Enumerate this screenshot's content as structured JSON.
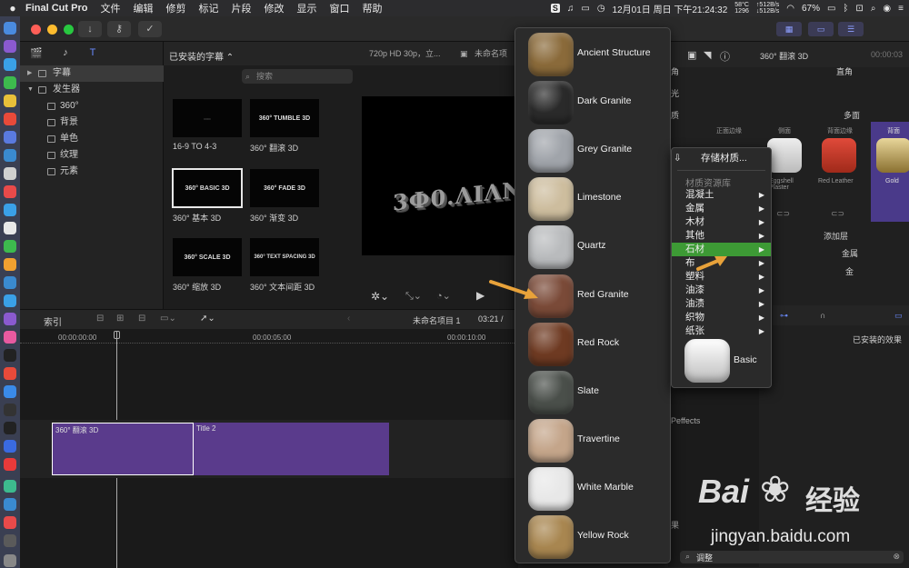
{
  "menubar": {
    "app": "Final Cut Pro",
    "items": [
      "文件",
      "编辑",
      "修剪",
      "标记",
      "片段",
      "修改",
      "显示",
      "窗口",
      "帮助"
    ],
    "clock": "12月01日 周日 下午21:24:32",
    "battery": "67%",
    "cpu_temp": "58°C",
    "cpu_rpm": "1296",
    "net_up": "↑512B/s",
    "net_down": "↓512B/s"
  },
  "sidebar": {
    "header": "已安装的字幕",
    "items": [
      {
        "label": "字幕",
        "level": 0,
        "expanded": false
      },
      {
        "label": "发生器",
        "level": 0,
        "expanded": true
      },
      {
        "label": "360°",
        "level": 1
      },
      {
        "label": "背景",
        "level": 1
      },
      {
        "label": "单色",
        "level": 1
      },
      {
        "label": "纹理",
        "level": 1
      },
      {
        "label": "元素",
        "level": 1
      }
    ]
  },
  "browser": {
    "search_placeholder": "搜索",
    "thumbs": [
      {
        "thumb": "",
        "label": "16-9 TO 4-3"
      },
      {
        "thumb": "360° TUMBLE 3D",
        "label": "360° 翻滚 3D"
      },
      {
        "thumb": "360° BASIC 3D",
        "label": "360° 基本 3D"
      },
      {
        "thumb": "360° FADE 3D",
        "label": "360° 渐变 3D"
      },
      {
        "thumb": "360° SCALE 3D",
        "label": "360° 缩放 3D"
      },
      {
        "thumb": "360° TEXT SPACING 3D",
        "label": "360° 文本间距 3D"
      }
    ]
  },
  "viewer": {
    "format": "720p HD 30p，立...",
    "project": "未命名项",
    "canvas_text": "3Ф0.ΛΙΛΝΒΓΕ"
  },
  "timeline": {
    "index_label": "索引",
    "project_name": "未命名项目 1",
    "timecode": "03:21 /",
    "ruler": [
      "00:00:00:00",
      "00:00:05:00",
      "00:00:10:00"
    ],
    "clips": [
      {
        "label": "360° 翻滚 3D"
      },
      {
        "label": "Title 2"
      }
    ]
  },
  "inspector": {
    "title": "360° 翻滚 3D",
    "timecode": "00:00:03",
    "lighting_label": "角",
    "lighting_value": "直角",
    "light_label": "光",
    "material_label": "质",
    "material_value": "多面",
    "tabs": [
      "正面边缘",
      "侧面",
      "背面边缘",
      "背面"
    ],
    "swatches": [
      "Eggshell Plaster",
      "Red Leather",
      "Gold"
    ],
    "add_layer": "添加层",
    "metal_value": "金属",
    "gold_value": "金",
    "effects_header": "已安装的效果",
    "effects_item": "Peffects",
    "search_value": "调整",
    "bottom_label": "果"
  },
  "texture_popup": {
    "items": [
      {
        "name": "Ancient Structure",
        "color": "#8a6a3a"
      },
      {
        "name": "Dark Granite",
        "color": "#2a2a2a"
      },
      {
        "name": "Grey Granite",
        "color": "#a0a4aa"
      },
      {
        "name": "Limestone",
        "color": "#cdbd9e"
      },
      {
        "name": "Quartz",
        "color": "#b9bbbd"
      },
      {
        "name": "Red Granite",
        "color": "#7a4a38"
      },
      {
        "name": "Red Rock",
        "color": "#6e3a22"
      },
      {
        "name": "Slate",
        "color": "#4a4f4a"
      },
      {
        "name": "Travertine",
        "color": "#c4a58a"
      },
      {
        "name": "White Marble",
        "color": "#e8e8e8"
      },
      {
        "name": "Yellow Rock",
        "color": "#a88650"
      }
    ]
  },
  "context_menu": {
    "save_label": "存储材质...",
    "library_header": "材质资源库",
    "items": [
      "混凝土",
      "金属",
      "木材",
      "其他",
      "石材",
      "布",
      "塑料",
      "油漆",
      "油渍",
      "织物",
      "纸张"
    ],
    "highlighted": "石材",
    "basic_label": "Basic"
  },
  "watermark": {
    "text": "jingyan.baidu.com",
    "brand": "Bai",
    "brand_cn": "经验"
  },
  "colors": {
    "accent_purple": "#5a3b8c",
    "highlight_green": "#3d9a35",
    "arrow_orange": "#e8a23a"
  }
}
